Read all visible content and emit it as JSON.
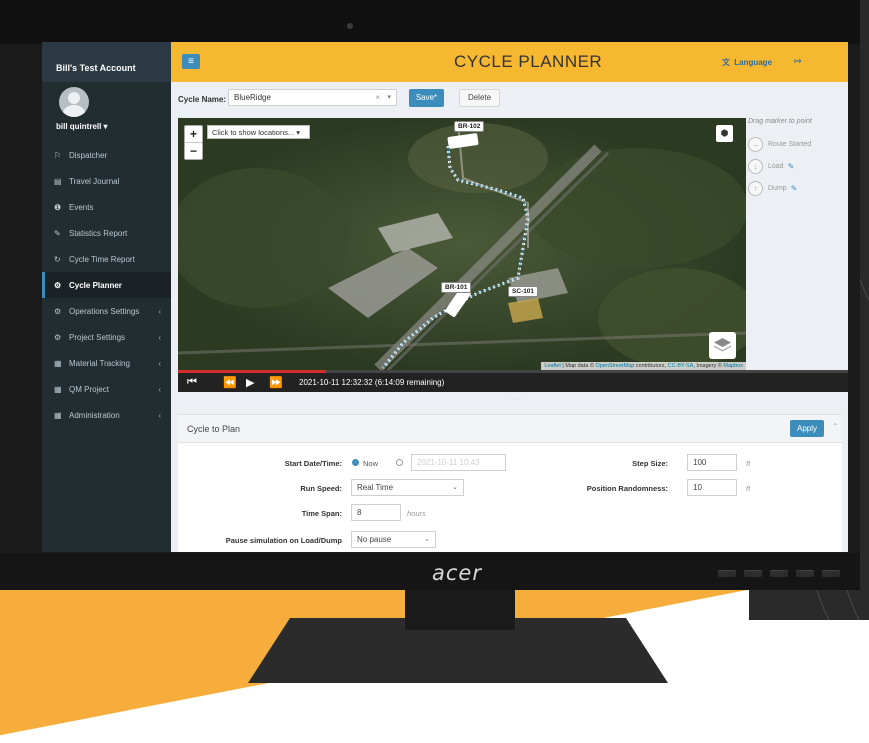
{
  "device": {
    "brand": "acer"
  },
  "sidebar": {
    "account_name": "Bill's Test Account",
    "user_name": "bill quintrell ▾",
    "items": [
      {
        "icon": "⚐",
        "label": "Dispatcher",
        "chevron": ""
      },
      {
        "icon": "▤",
        "label": "Travel Journal",
        "chevron": ""
      },
      {
        "icon": "❶",
        "label": "Events",
        "chevron": ""
      },
      {
        "icon": "✎",
        "label": "Statistics Report",
        "chevron": ""
      },
      {
        "icon": "↻",
        "label": "Cycle Time Report",
        "chevron": ""
      },
      {
        "icon": "⚙",
        "label": "Cycle Planner",
        "chevron": "",
        "active": true
      },
      {
        "icon": "⚙",
        "label": "Operations Settings",
        "chevron": "‹"
      },
      {
        "icon": "⚙",
        "label": "Project Settings",
        "chevron": "‹"
      },
      {
        "icon": "▦",
        "label": "Material Tracking",
        "chevron": "‹"
      },
      {
        "icon": "▦",
        "label": "QM Project",
        "chevron": "‹"
      },
      {
        "icon": "▦",
        "label": "Administration",
        "chevron": "‹"
      }
    ]
  },
  "header": {
    "menu_icon": "≡",
    "title": "CYCLE PLANNER",
    "language_icon": "文",
    "language_label": "Language",
    "logout_icon": "↦"
  },
  "toolbar": {
    "cycle_name_label": "Cycle Name:",
    "cycle_name_value": "BlueRidge",
    "clear_icon": "×",
    "caret_icon": "▾",
    "save_label": "Save*",
    "delete_label": "Delete"
  },
  "map": {
    "zoom_in": "+",
    "zoom_out": "−",
    "locations_dropdown": "Click to show locations... ▾",
    "fullscreen_icon": "⬢",
    "markers": {
      "br102": "BR-102",
      "br101": "BR-101",
      "sc101": "SC-101"
    },
    "attribution": {
      "leaflet": "Leaflet",
      "map_data": " | Map data © ",
      "osm": "OpenStreetMap",
      "contributors": " contributors, ",
      "license": "CC-BY-SA",
      "imagery": ", Imagery © ",
      "mapbox": "Mapbox"
    },
    "route_color": "#ffffff",
    "route_outline": "#3c8dbc"
  },
  "legend": {
    "hint": "Drag marker to point",
    "route_started_icon": "→",
    "route_started": "Route Started",
    "load_icon": "↓",
    "load": "Load",
    "dump_icon": "↑",
    "dump": "Dump",
    "edit_icon": "✎"
  },
  "player": {
    "skip_back": "⏮",
    "rewind": "⏪",
    "play": "▶",
    "fast_forward": "⏩",
    "time_display": "2021-10-11 12:32:32 (6:14:09 remaining)",
    "progress_fraction": 0.22
  },
  "panel": {
    "title": "Cycle to Plan",
    "apply_label": "Apply",
    "collapse_icon": "⌃",
    "start_label": "Start Date/Time:",
    "now_label": "Now",
    "start_value": "2021-10-11 10:43",
    "step_label": "Step Size:",
    "step_value": "100",
    "step_unit": "ft",
    "run_speed_label": "Run Speed:",
    "run_speed_value": "Real Time",
    "randomness_label": "Position Randomness:",
    "randomness_value": "10",
    "randomness_unit": "ft",
    "timespan_label": "Time Span:",
    "timespan_value": "8",
    "timespan_unit": "hours",
    "pause_label": "Pause simulation on Load/Dump",
    "pause_value": "No pause",
    "select_caret": "⌄"
  },
  "colors": {
    "accent": "#3c8dbc",
    "header": "#f6b731",
    "sidebar": "#222d32",
    "progress": "#d62b2b"
  }
}
